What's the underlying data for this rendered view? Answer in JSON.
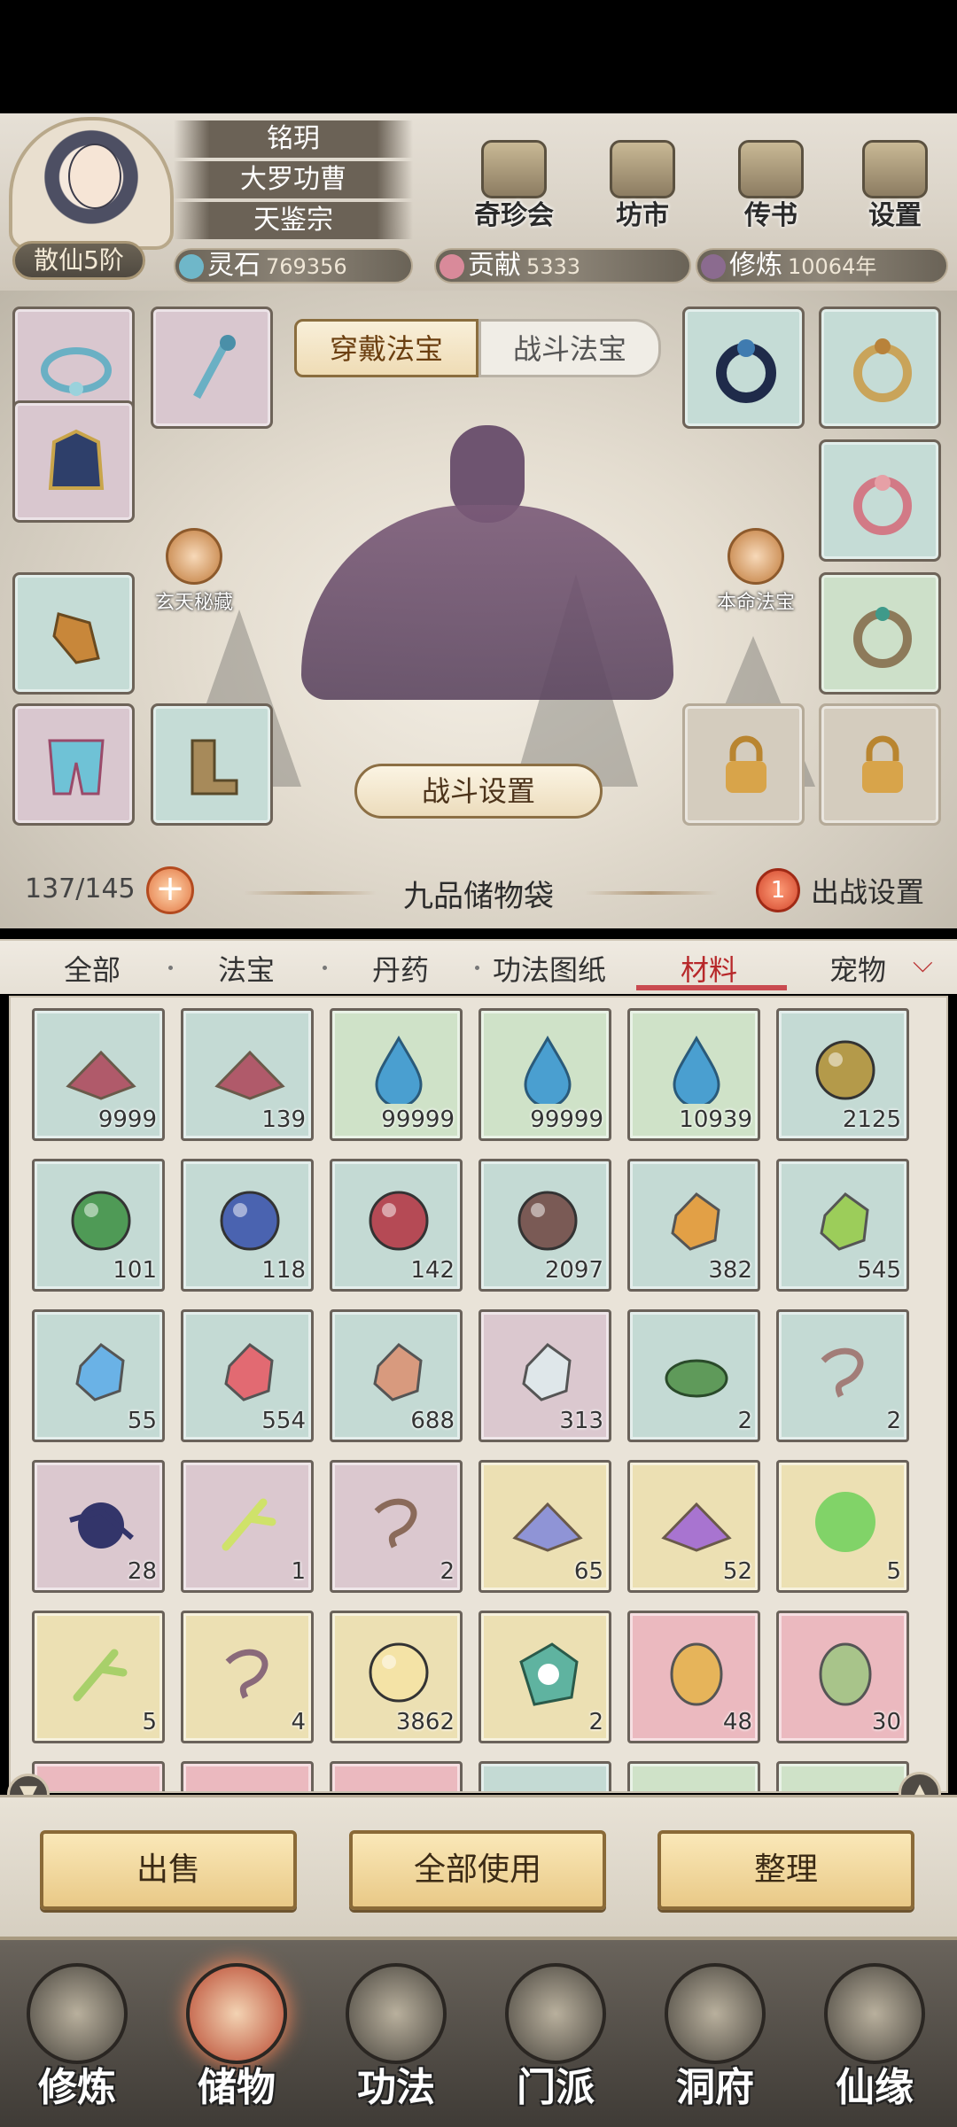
{
  "player": {
    "names": [
      "铭玥",
      "大罗功曹",
      "天鉴宗"
    ],
    "rank": "散仙5阶"
  },
  "top_buttons": [
    {
      "label": "奇珍会",
      "icon": "treasure-pavilion-icon"
    },
    {
      "label": "坊市",
      "icon": "market-icon"
    },
    {
      "label": "传书",
      "icon": "scroll-letter-icon"
    },
    {
      "label": "设置",
      "icon": "gear-icon"
    }
  ],
  "resources": [
    {
      "label": "灵石",
      "value": "769356",
      "icon": "spirit-stone-icon",
      "color": "#6fb7c9"
    },
    {
      "label": "贡献",
      "value": "5333",
      "icon": "contribution-icon",
      "color": "#d98a9a"
    },
    {
      "label": "修炼",
      "value": "10064年",
      "icon": "cultivation-icon",
      "color": "#8b6b8f"
    }
  ],
  "equip_tabs": {
    "active": "穿戴法宝",
    "inactive": "战斗法宝"
  },
  "side_skills": {
    "left": "玄天秘藏",
    "right": "本命法宝"
  },
  "battle_settings_label": "战斗设置",
  "bag": {
    "capacity": "137/145",
    "plus": "+",
    "title": "九品储物袋",
    "sortie_count": "1",
    "sortie_label": "出战设置"
  },
  "categories": [
    "全部",
    "法宝",
    "丹药",
    "功法图纸",
    "材料",
    "宠物"
  ],
  "active_category": "材料",
  "items": [
    {
      "name": "crimson-sand",
      "count": "9999",
      "bg": "teal",
      "color": "#b05a6a"
    },
    {
      "name": "crimson-sand",
      "count": "139",
      "bg": "teal",
      "color": "#b05a6a"
    },
    {
      "name": "water-drop",
      "count": "99999",
      "bg": "green",
      "color": "#4a9fd0"
    },
    {
      "name": "water-drop",
      "count": "99999",
      "bg": "green",
      "color": "#4a9fd0"
    },
    {
      "name": "water-drop",
      "count": "10939",
      "bg": "green",
      "color": "#4a9fd0"
    },
    {
      "name": "golden-orb",
      "count": "2125",
      "bg": "teal",
      "color": "#b49a4a"
    },
    {
      "name": "green-orb",
      "count": "101",
      "bg": "teal",
      "color": "#4f9a56"
    },
    {
      "name": "blue-orb",
      "count": "118",
      "bg": "teal",
      "color": "#4a63b0"
    },
    {
      "name": "red-orb",
      "count": "142",
      "bg": "teal",
      "color": "#b54a55"
    },
    {
      "name": "brown-orb",
      "count": "2097",
      "bg": "teal",
      "color": "#7a5a55"
    },
    {
      "name": "amber-crystal",
      "count": "382",
      "bg": "teal",
      "color": "#e2a046"
    },
    {
      "name": "jade-crystal",
      "count": "545",
      "bg": "teal",
      "color": "#9ccd5a"
    },
    {
      "name": "blue-crystal",
      "count": "55",
      "bg": "teal",
      "color": "#6ab2e6"
    },
    {
      "name": "ruby-crystal",
      "count": "554",
      "bg": "teal",
      "color": "#e26a72"
    },
    {
      "name": "peach-crystal",
      "count": "688",
      "bg": "teal",
      "color": "#d89a7e"
    },
    {
      "name": "white-crystal",
      "count": "313",
      "bg": "pink",
      "color": "#dfe7ea"
    },
    {
      "name": "green-frog-stone",
      "count": "2",
      "bg": "teal",
      "color": "#5f9a5a"
    },
    {
      "name": "chain-link",
      "count": "2",
      "bg": "teal",
      "color": "#a27d78"
    },
    {
      "name": "shadow-fruit",
      "count": "28",
      "bg": "pink",
      "color": "#33356a"
    },
    {
      "name": "bone-branch",
      "count": "1",
      "bg": "pink",
      "color": "#cfe26a"
    },
    {
      "name": "rope-coil",
      "count": "2",
      "bg": "pink",
      "color": "#8a6a5a"
    },
    {
      "name": "blue-powder",
      "count": "65",
      "bg": "yellow",
      "color": "#8f94d6"
    },
    {
      "name": "purple-powder",
      "count": "52",
      "bg": "yellow",
      "color": "#a874d0"
    },
    {
      "name": "green-mist",
      "count": "5",
      "bg": "yellow",
      "color": "#6fd05a"
    },
    {
      "name": "glowing-branch",
      "count": "5",
      "bg": "yellow",
      "color": "#a8d06a"
    },
    {
      "name": "glowing-rope",
      "count": "4",
      "bg": "yellow",
      "color": "#8a6a7a"
    },
    {
      "name": "light-orb",
      "count": "3862",
      "bg": "yellow",
      "color": "#f4e3a6"
    },
    {
      "name": "yin-yang-jade",
      "count": "2",
      "bg": "yellow",
      "color": "#5fb3a0"
    },
    {
      "name": "amber-egg",
      "count": "48",
      "bg": "red",
      "color": "#e6b45a"
    },
    {
      "name": "jade-egg",
      "count": "30",
      "bg": "red",
      "color": "#a8c48a"
    }
  ],
  "partial_row_bgs": [
    "red",
    "red",
    "red",
    "teal",
    "green",
    "green"
  ],
  "actions": [
    "出售",
    "全部使用",
    "整理"
  ],
  "nav": [
    {
      "label": "修炼",
      "icon": "cultivate-icon"
    },
    {
      "label": "储物",
      "icon": "storage-bag-icon",
      "active": true
    },
    {
      "label": "功法",
      "icon": "technique-scroll-icon"
    },
    {
      "label": "门派",
      "icon": "sect-gate-icon"
    },
    {
      "label": "洞府",
      "icon": "cave-abode-icon"
    },
    {
      "label": "仙缘",
      "icon": "immortal-fate-icon"
    }
  ]
}
